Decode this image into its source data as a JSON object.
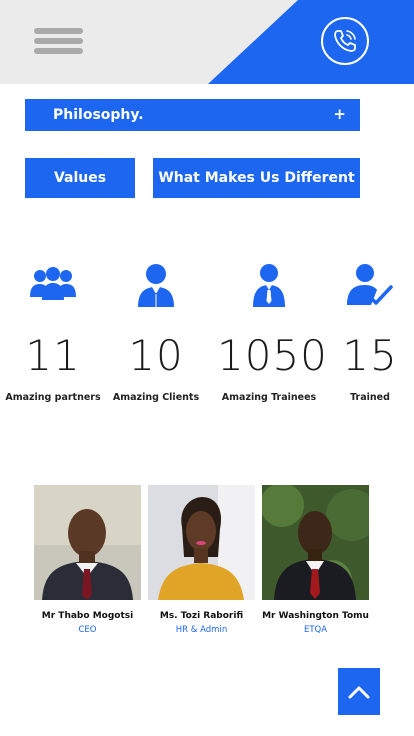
{
  "header": {
    "menu_icon": "hamburger-menu-icon",
    "phone_icon": "phone-call-icon",
    "colors": {
      "bar": "#ebebeb",
      "accent": "#1d66f0"
    }
  },
  "accordion": {
    "label": "Philosophy.",
    "toggle": "+"
  },
  "tabs": [
    {
      "label": "Values"
    },
    {
      "label": "What Makes Us Different"
    }
  ],
  "stats": [
    {
      "value": "11",
      "caption": "Amazing partners",
      "icon": "group-icon"
    },
    {
      "value": "10",
      "caption": "Amazing Clients",
      "icon": "user-suit-icon"
    },
    {
      "value": "1050",
      "caption": "Amazing Trainees",
      "icon": "user-tie-icon"
    },
    {
      "value": "15",
      "caption": "Trained",
      "icon": "user-check-icon"
    }
  ],
  "team": [
    {
      "name": "Mr Thabo Mogotsi",
      "role": "CEO"
    },
    {
      "name": "Ms. Tozi Raborifi",
      "role": "HR & Admin"
    },
    {
      "name": "Mr Washington Tomu",
      "role": "ETQA"
    }
  ],
  "back_to_top_icon": "chevron-up-icon"
}
